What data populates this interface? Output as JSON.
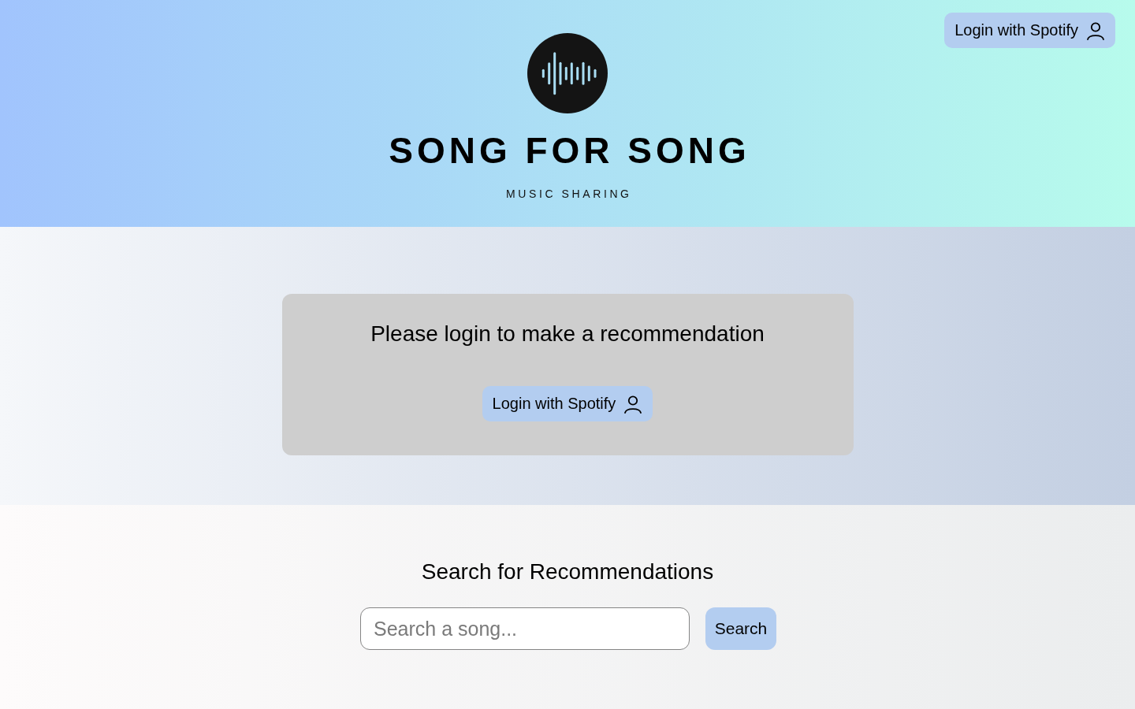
{
  "header": {
    "logo": {
      "title": "SONG FOR SONG",
      "subtitle": "MUSIC SHARING"
    },
    "login_button": {
      "label": "Login with Spotify"
    }
  },
  "login_card": {
    "message": "Please login to make a recommendation",
    "login_button": {
      "label": "Login with Spotify"
    }
  },
  "search": {
    "heading": "Search for Recommendations",
    "placeholder": "Search a song...",
    "button": {
      "label": "Search"
    }
  }
}
